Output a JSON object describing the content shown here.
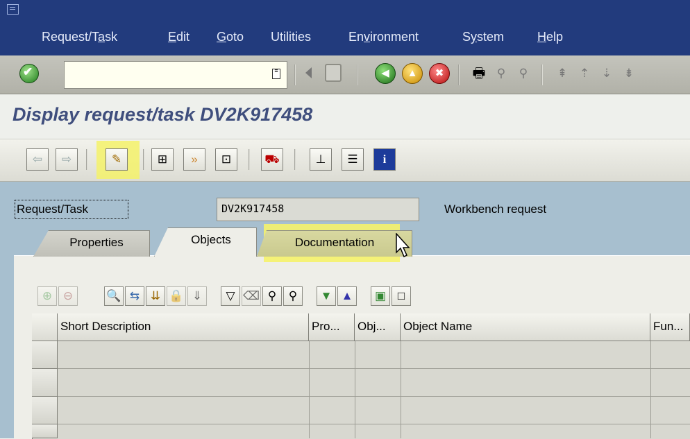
{
  "menu": {
    "items": [
      {
        "pre": "Request/T",
        "u": "a",
        "post": "sk"
      },
      {
        "pre": "",
        "u": "E",
        "post": "dit"
      },
      {
        "pre": "",
        "u": "G",
        "post": "oto"
      },
      {
        "pre": "Utilities",
        "u": "",
        "post": ""
      },
      {
        "pre": "En",
        "u": "v",
        "post": "ironment"
      },
      {
        "pre": "S",
        "u": "y",
        "post": "stem"
      },
      {
        "pre": "",
        "u": "H",
        "post": "elp"
      }
    ]
  },
  "command_field": {
    "value": ""
  },
  "page_title": "Display request/task DV2K917458",
  "request": {
    "label": "Request/Task",
    "value": "DV2K917458",
    "type": "Workbench request"
  },
  "tabs": [
    {
      "label": "Properties",
      "state": "inactive"
    },
    {
      "label": "Objects",
      "state": "active"
    },
    {
      "label": "Documentation",
      "state": "highlighted"
    }
  ],
  "table": {
    "columns": [
      "Short Description",
      "Pro...",
      "Obj...",
      "Object Name",
      "Fun..."
    ],
    "rows": [
      [],
      [],
      []
    ]
  },
  "colors": {
    "menubar": "#223b7d",
    "title": "#3f4e7d",
    "screen_bg": "#a7bfcf",
    "highlight": "#f5f26a"
  },
  "icons": {
    "system_toolbar": [
      "enter-icon",
      "command-history-icon",
      "back-arrow-icon",
      "save-icon",
      "back-icon",
      "exit-icon",
      "cancel-icon",
      "print-icon",
      "find-icon",
      "find-next-icon",
      "first-page-icon",
      "previous-page-icon",
      "next-page-icon"
    ],
    "application_toolbar": [
      "previous-object-icon",
      "next-object-icon",
      "display-change-icon",
      "object-directory-icon",
      "check-objects-icon",
      "hierarchy-icon",
      "release-icon",
      "tree-icon",
      "list-icon",
      "info-icon"
    ]
  }
}
